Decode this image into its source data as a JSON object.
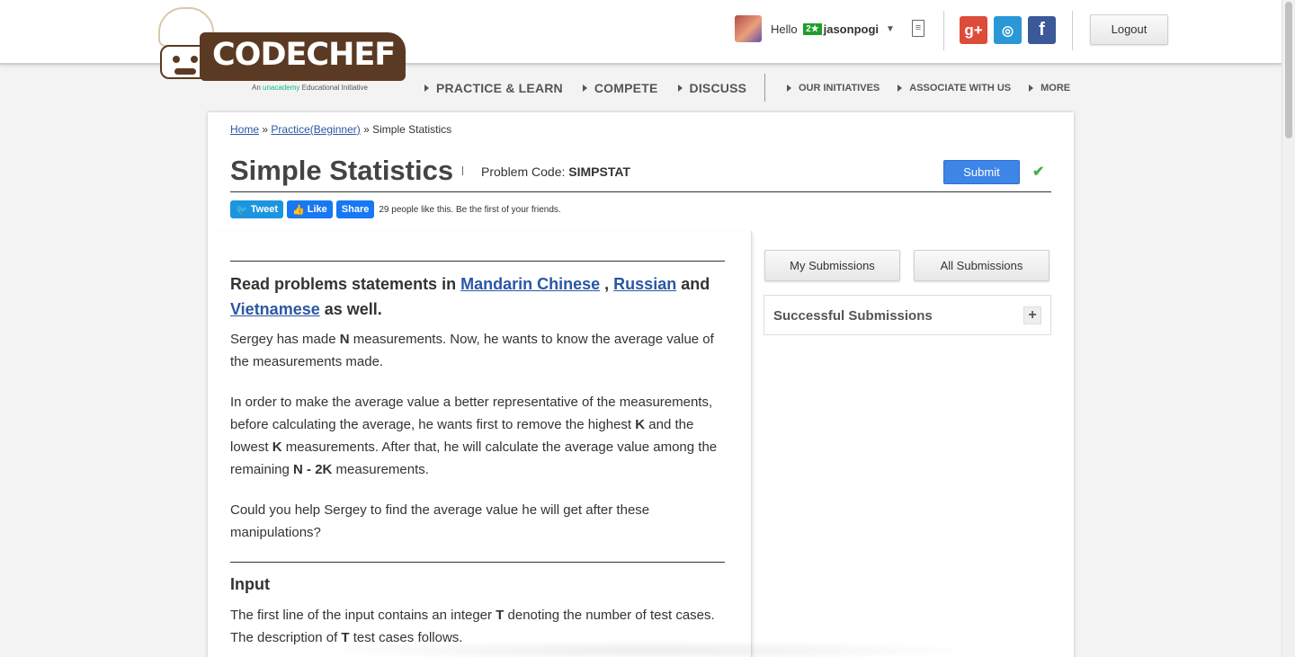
{
  "brand": {
    "name": "CODECHEF",
    "tagline_prefix": "An",
    "tagline_brand": "unacademy",
    "tagline_suffix": "Educational Initiative"
  },
  "header": {
    "greeting": "Hello",
    "rating_badge": "2★",
    "username": "jasonpogi",
    "dropdown_caret": "▼",
    "logout_label": "Logout",
    "social": {
      "google": "g+",
      "github": "◎",
      "facebook": "f"
    }
  },
  "nav": {
    "main": [
      "PRACTICE & LEARN",
      "COMPETE",
      "DISCUSS"
    ],
    "secondary": [
      "OUR INITIATIVES",
      "ASSOCIATE WITH US",
      "MORE"
    ]
  },
  "breadcrumb": {
    "home": "Home",
    "sep": "»",
    "practice": "Practice(Beginner)",
    "current": "Simple Statistics"
  },
  "problem": {
    "title": "Simple Statistics",
    "code_label": "Problem Code:",
    "code": "SIMPSTAT",
    "submit_label": "Submit",
    "check": "✔"
  },
  "share": {
    "tweet": "Tweet",
    "like": "Like",
    "share": "Share",
    "likes_text": "29 people like this. Be the first of your friends."
  },
  "statement": {
    "read_prefix": "Read problems statements in",
    "lang1": "Mandarin Chinese",
    "comma": ",",
    "lang2": "Russian",
    "and": "and",
    "lang3": "Vietnamese",
    "read_suffix": "as well.",
    "p1": [
      {
        "t": "Sergey has made "
      },
      {
        "b": "N"
      },
      {
        "t": " measurements. Now, he wants to know the average value of the measurements made."
      }
    ],
    "p2": [
      {
        "t": "In order to make the average value a better representative of the measurements, before calculating the average, he wants first to remove the highest "
      },
      {
        "b": "K"
      },
      {
        "t": " and the lowest "
      },
      {
        "b": "K"
      },
      {
        "t": " measurements. After that, he will calculate the average value among the remaining "
      },
      {
        "b": "N - 2K"
      },
      {
        "t": " measurements."
      }
    ],
    "p3": [
      {
        "t": "Could you help Sergey to find the average value he will get after these manipulations?"
      }
    ],
    "input_heading": "Input",
    "p4": [
      {
        "t": "The first line of the input contains an integer "
      },
      {
        "b": "T"
      },
      {
        "t": " denoting the number of test cases. The description of "
      },
      {
        "b": "T"
      },
      {
        "t": " test cases follows."
      }
    ]
  },
  "sidebar": {
    "my_submissions": "My Submissions",
    "all_submissions": "All Submissions",
    "successful_submissions": "Successful Submissions",
    "expand": "+"
  }
}
